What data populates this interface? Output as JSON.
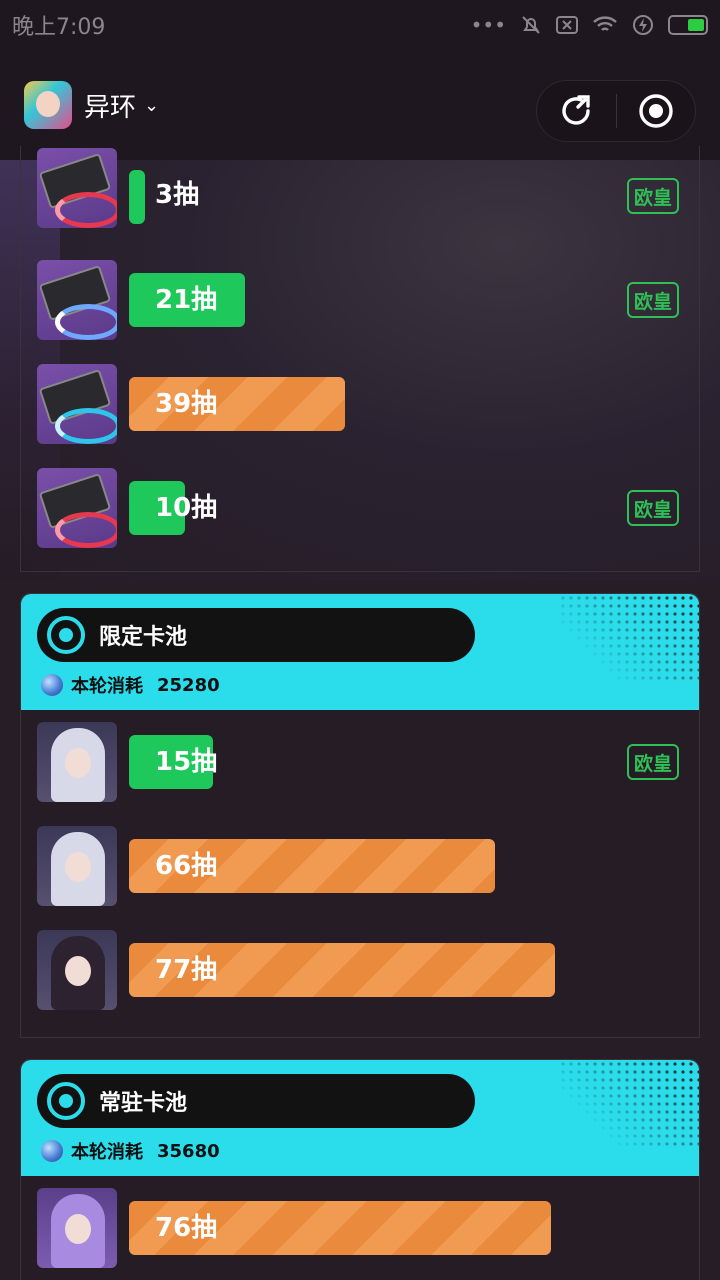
{
  "status_bar": {
    "time": "晚上7:09"
  },
  "app": {
    "name": "异环"
  },
  "top_rows": [
    {
      "pulls": "3抽",
      "badge": "欧皇"
    },
    {
      "pulls": "21抽",
      "badge": "欧皇"
    },
    {
      "pulls": "39抽",
      "badge": ""
    },
    {
      "pulls": "10抽",
      "badge": "欧皇"
    }
  ],
  "limited_pool": {
    "title": "限定卡池",
    "cost_label": "本轮消耗",
    "cost_value": "25280",
    "rows": [
      {
        "pulls": "15抽",
        "badge": "欧皇"
      },
      {
        "pulls": "66抽",
        "badge": ""
      },
      {
        "pulls": "77抽",
        "badge": ""
      }
    ]
  },
  "standard_pool": {
    "title": "常驻卡池",
    "cost_label": "本轮消耗",
    "cost_value": "35680",
    "rows": [
      {
        "pulls": "76抽",
        "badge": ""
      }
    ]
  },
  "colors": {
    "green": "#1ec85a",
    "orange": "#ea8a3c",
    "cyan": "#2bdceb",
    "badge": "#2fbf55"
  }
}
